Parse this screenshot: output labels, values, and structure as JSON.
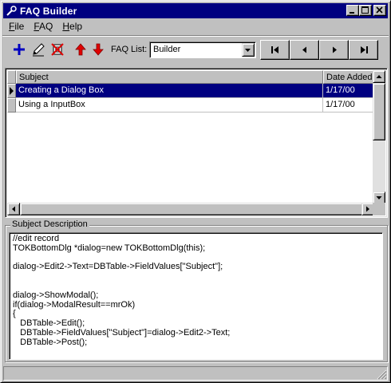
{
  "window": {
    "title": "FAQ Builder"
  },
  "menu": [
    {
      "label": "File",
      "accel": "F",
      "rest": "ile"
    },
    {
      "label": "FAQ",
      "accel": "F",
      "rest": "AQ"
    },
    {
      "label": "Help",
      "accel": "H",
      "rest": "elp"
    }
  ],
  "toolbar": {
    "faq_list_label": "FAQ List:",
    "faq_list_value": "Builder",
    "icons": [
      "add-icon",
      "edit-icon",
      "delete-icon",
      "move-up-icon",
      "move-down-icon"
    ],
    "nav": [
      "first-record-icon",
      "previous-record-icon",
      "next-record-icon",
      "last-record-icon"
    ]
  },
  "grid": {
    "columns": [
      "Subject",
      "Date Added"
    ],
    "rows": [
      {
        "subject": "Creating a Dialog Box",
        "date": "1/17/00",
        "selected": true
      },
      {
        "subject": "Using a InputBox",
        "date": "1/17/00",
        "selected": false
      }
    ]
  },
  "description": {
    "label": "Subject Description",
    "lines": [
      "//edit record",
      "TOKBottomDlg *dialog=new TOKBottomDlg(this);",
      "",
      "dialog->Edit2->Text=DBTable->FieldValues[\"Subject\"];",
      "",
      "",
      "dialog->ShowModal();",
      "if(dialog->ModalResult==mrOk)",
      "{",
      "   DBTable->Edit();",
      "   DBTable->FieldValues[\"Subject\"]=dialog->Edit2->Text;",
      "   DBTable->Post();"
    ]
  },
  "colors": {
    "titlebar": "#000080",
    "selection": "#000080",
    "face": "#c0c0c0",
    "arrow_red": "#e00000",
    "add_blue": "#0000c0"
  }
}
